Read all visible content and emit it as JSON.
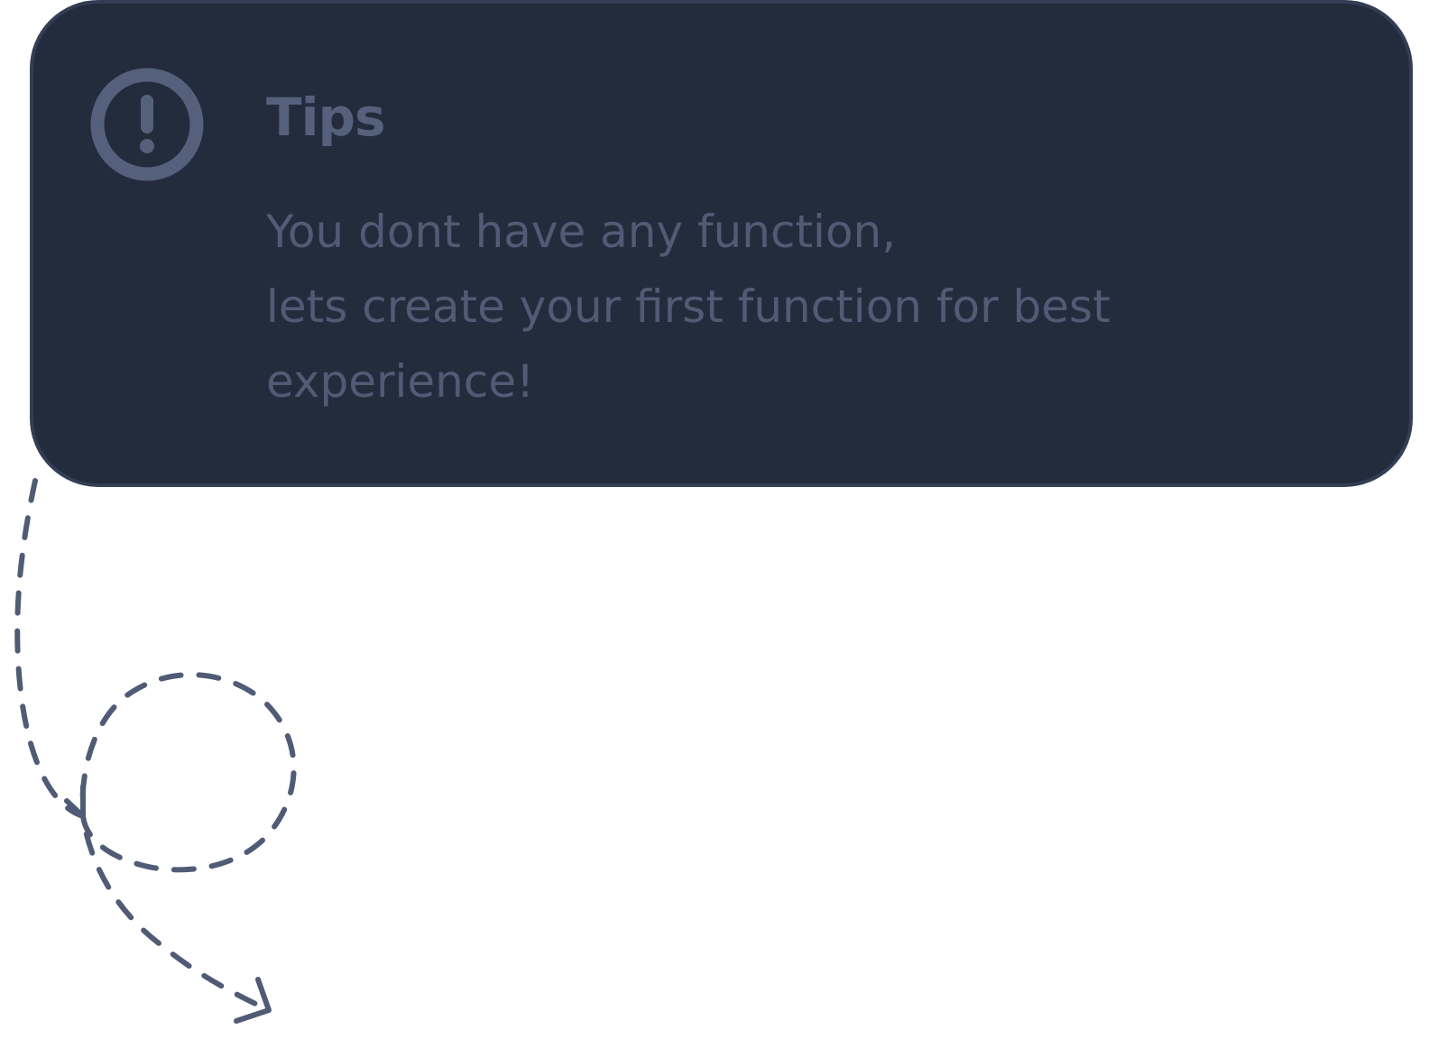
{
  "tip": {
    "title": "Tips",
    "body_lines": [
      "You dont have any function,",
      "lets create your first function for best",
      "experience!"
    ],
    "icon": "alert-circle-icon"
  },
  "decoration": {
    "icon": "dashed-loop-arrow-icon"
  },
  "colors": {
    "card_background": "#232c3d",
    "card_border": "#333e55",
    "accent": "#55617c",
    "text": "#505b75",
    "page_background": "#ffffff"
  }
}
